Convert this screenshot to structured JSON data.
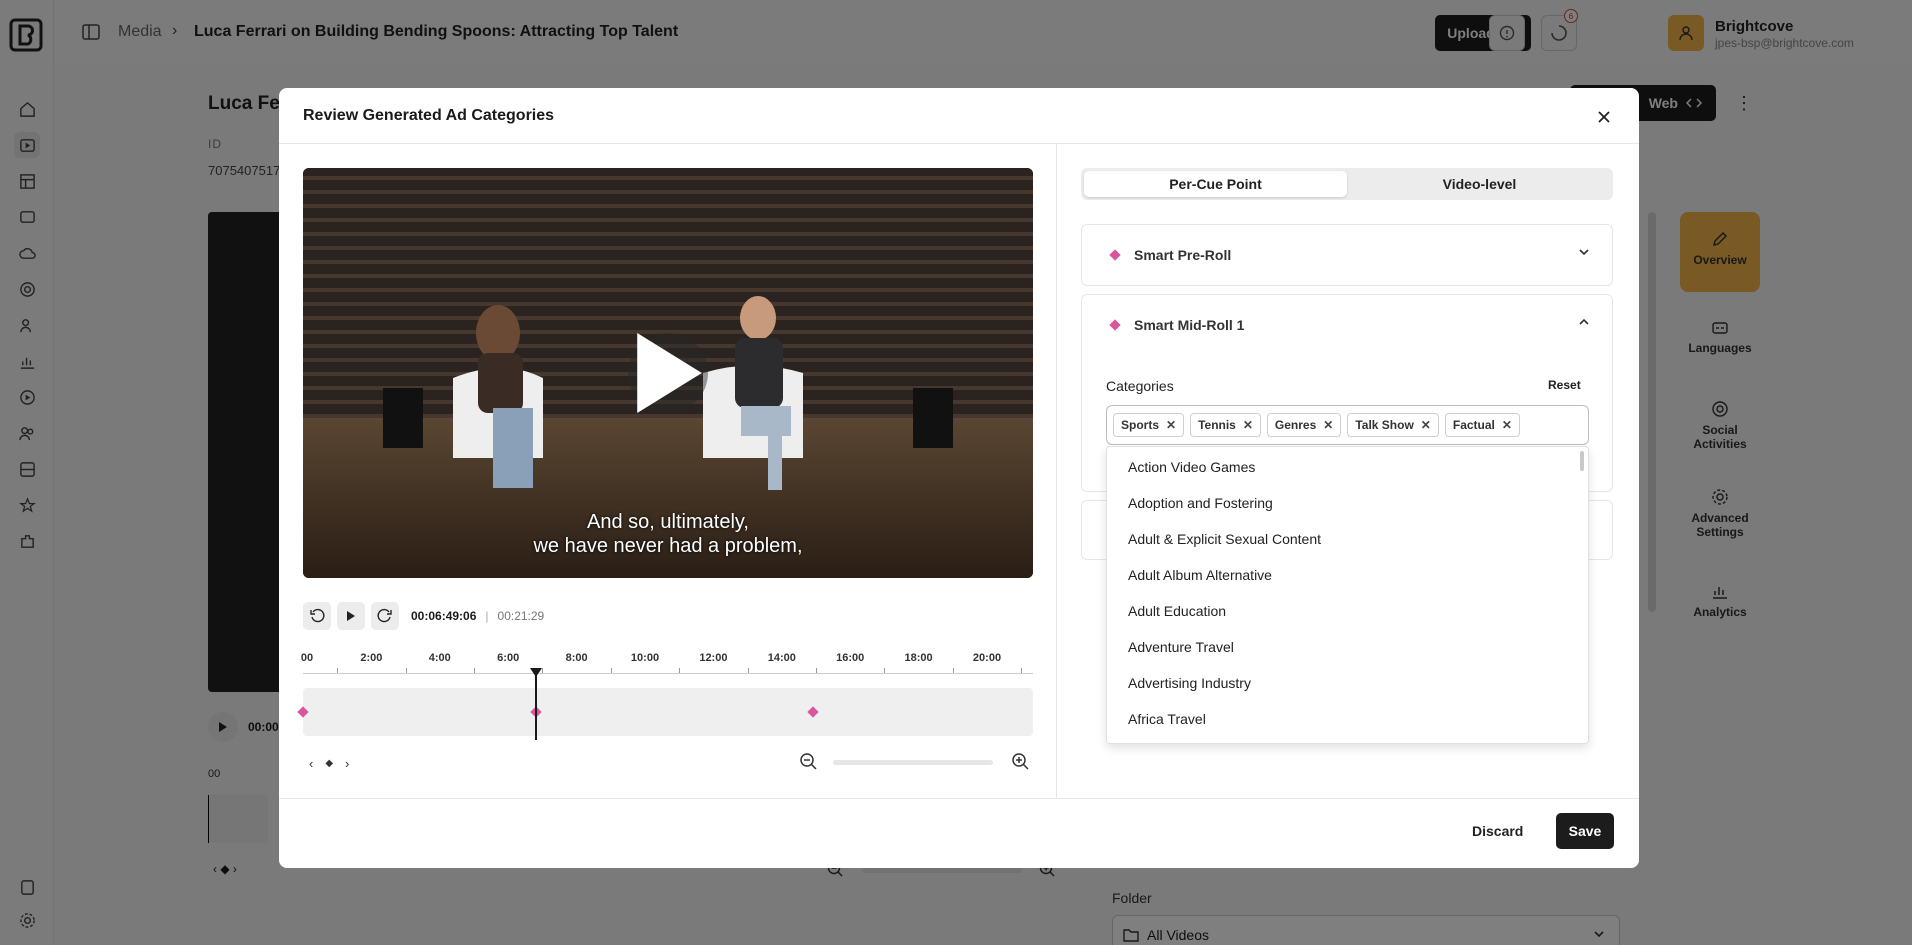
{
  "topbar": {
    "breadcrumb_root": "Media",
    "breadcrumb_sep": "›",
    "breadcrumb_title": "Luca Ferrari on Building Bending Spoons: Attracting Top Talent",
    "upload_label": "Upload",
    "notification_count": "6"
  },
  "account": {
    "name": "Brightcove",
    "email": "jpes-bsp@brightcove.com"
  },
  "background": {
    "title": "Luca Fer",
    "id_label": "ID",
    "id_value": "7075407517",
    "time": "00:00",
    "ruler_fragment": "00",
    "web_button": "Web",
    "folder_label": "Folder",
    "folder_value": "All Videos",
    "right_nav": [
      {
        "label": "Overview",
        "icon": "pencil-icon"
      },
      {
        "label": "Languages",
        "icon": "languages-icon"
      },
      {
        "label": "Social Activities",
        "icon": "social-icon"
      },
      {
        "label": "Advanced Settings",
        "icon": "gear-icon"
      },
      {
        "label": "Analytics",
        "icon": "analytics-icon"
      }
    ]
  },
  "modal": {
    "title": "Review Generated Ad Categories",
    "player": {
      "subtitle_line1": "And so, ultimately,",
      "subtitle_line2": "we have never had a problem,",
      "current_time": "00:06:49:06",
      "duration": "00:21:29",
      "time_separator": "|"
    },
    "timeline": {
      "tick_labels": [
        "00",
        "2:00",
        "4:00",
        "6:00",
        "8:00",
        "10:00",
        "12:00",
        "14:00",
        "16:00",
        "18:00",
        "20:00"
      ],
      "cue_point_times_min": [
        0.0,
        6.82,
        14.9
      ],
      "playhead_min": 6.82
    },
    "tabs": [
      {
        "label": "Per-Cue Point",
        "active": true
      },
      {
        "label": "Video-level",
        "active": false
      }
    ],
    "sections": [
      {
        "label": "Smart Pre-Roll",
        "expanded": false
      },
      {
        "label": "Smart Mid-Roll 1",
        "expanded": true
      }
    ],
    "categories_label": "Categories",
    "reset_label": "Reset",
    "chips": [
      "Sports",
      "Tennis",
      "Genres",
      "Talk Show",
      "Factual"
    ],
    "dropdown_options": [
      "Action Video Games",
      "Adoption and Fostering",
      "Adult & Explicit Sexual Content",
      "Adult Album Alternative",
      "Adult Education",
      "Adventure Travel",
      "Advertising Industry",
      "Africa Travel"
    ],
    "discard_label": "Discard",
    "save_label": "Save"
  },
  "colors": {
    "accent": "#d9559e",
    "primary_button": "#1c1c1c",
    "active_nav": "#f2b54a"
  }
}
